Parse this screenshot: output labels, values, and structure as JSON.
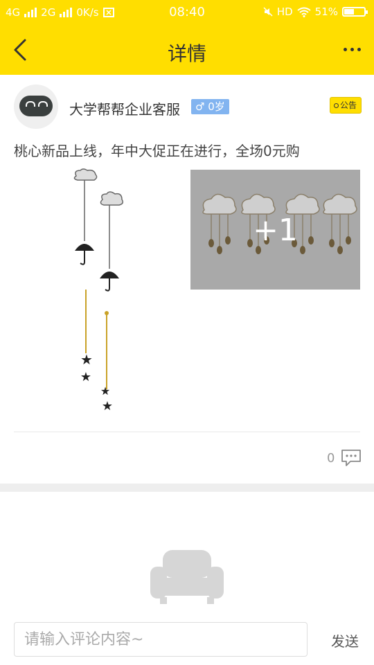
{
  "status_bar": {
    "network1": "4G",
    "network2": "2G",
    "speed": "0K/s",
    "time": "08:40",
    "hd": "HD",
    "battery": "51%",
    "battery_level": 0.51
  },
  "header": {
    "title": "详情"
  },
  "post": {
    "username": "大学帮帮企业客服",
    "gender_age": "♂ 0岁",
    "tag": "公告",
    "content": "桃心新品上线，年中大促正在进行，全场0元购",
    "more_images": "+1",
    "comment_count": "0"
  },
  "comment_bar": {
    "placeholder": "请输入评论内容~",
    "send_label": "发送"
  },
  "colors": {
    "accent": "#FFDE00",
    "badge": "#82B4F0"
  }
}
